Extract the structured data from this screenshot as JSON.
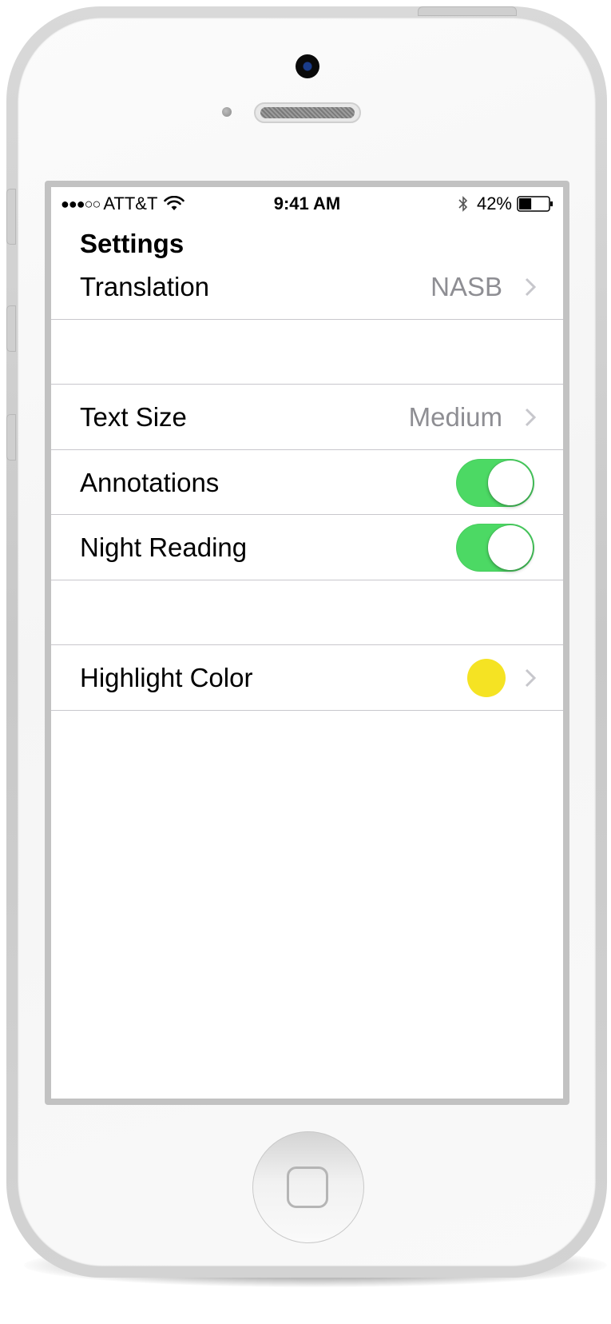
{
  "status_bar": {
    "signal": "●●●○○",
    "carrier": "ATT&T",
    "time": "9:41 AM",
    "battery_percent": "42%",
    "battery_level": 0.42
  },
  "nav": {
    "title": "Settings"
  },
  "rows": {
    "translation": {
      "label": "Translation",
      "value": "NASB"
    },
    "text_size": {
      "label": "Text Size",
      "value": "Medium"
    },
    "annotations": {
      "label": "Annotations",
      "on": true
    },
    "night_reading": {
      "label": "Night Reading",
      "on": true
    },
    "highlight_color": {
      "label": "Highlight Color",
      "color": "#f5e323"
    }
  },
  "colors": {
    "toggle_on": "#4cd964",
    "secondary_text": "#8e8e93",
    "separator": "#c8c7cc"
  }
}
